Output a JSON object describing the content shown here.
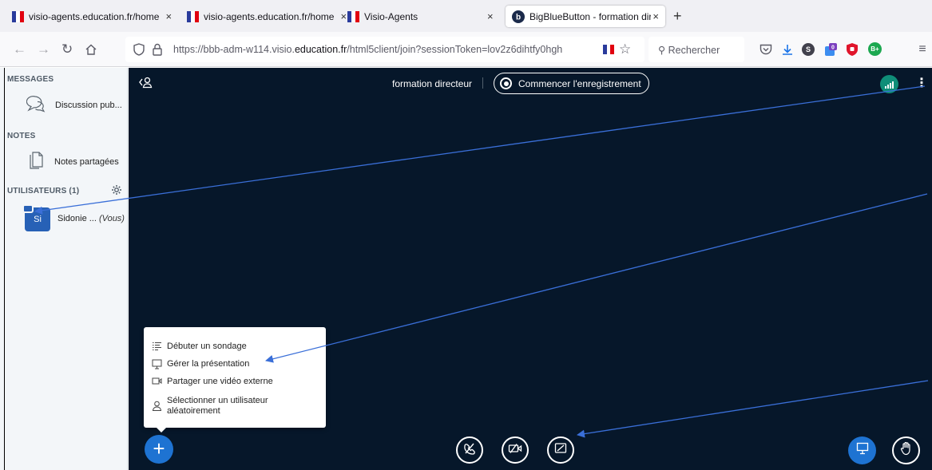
{
  "browser": {
    "tabs": [
      {
        "label": "visio-agents.education.fr/home",
        "close": "×"
      },
      {
        "label": "visio-agents.education.fr/home",
        "close": "×"
      },
      {
        "label": "Visio-Agents",
        "close": "×"
      },
      {
        "label": "BigBlueButton - formation direc",
        "close": "×"
      }
    ],
    "new_tab": "+",
    "url": {
      "prefix": "https://bbb-adm-w114.visio.",
      "domain": "education.fr",
      "suffix": "/html5client/join?sessionToken=lov2z6dihtfy0hgh"
    },
    "search_placeholder": "Rechercher",
    "pocket_badge": "0",
    "profile_initials": "B+",
    "sync_initial": "S"
  },
  "sidebar": {
    "messages_title": "MESSAGES",
    "public_chat": "Discussion pub...",
    "notes_title": "NOTES",
    "shared_notes": "Notes partagées",
    "users_title": "UTILISATEURS (1)",
    "user": {
      "initials": "Si",
      "name": "Sidonie ...",
      "you": "(Vous)"
    }
  },
  "header": {
    "meeting_title": "formation directeur",
    "record_label": "Commencer l'enregistrement"
  },
  "actions_menu": {
    "items": [
      {
        "label": "Débuter un sondage"
      },
      {
        "label": "Gérer la présentation"
      },
      {
        "label": "Partager une vidéo externe"
      },
      {
        "label": "Sélectionner un utilisateur aléatoirement"
      }
    ]
  },
  "colors": {
    "main_bg": "#06172a",
    "accent": "#1e73d2",
    "annotation_arrow": "#3a6fd8",
    "connection": "#0f8e78"
  }
}
